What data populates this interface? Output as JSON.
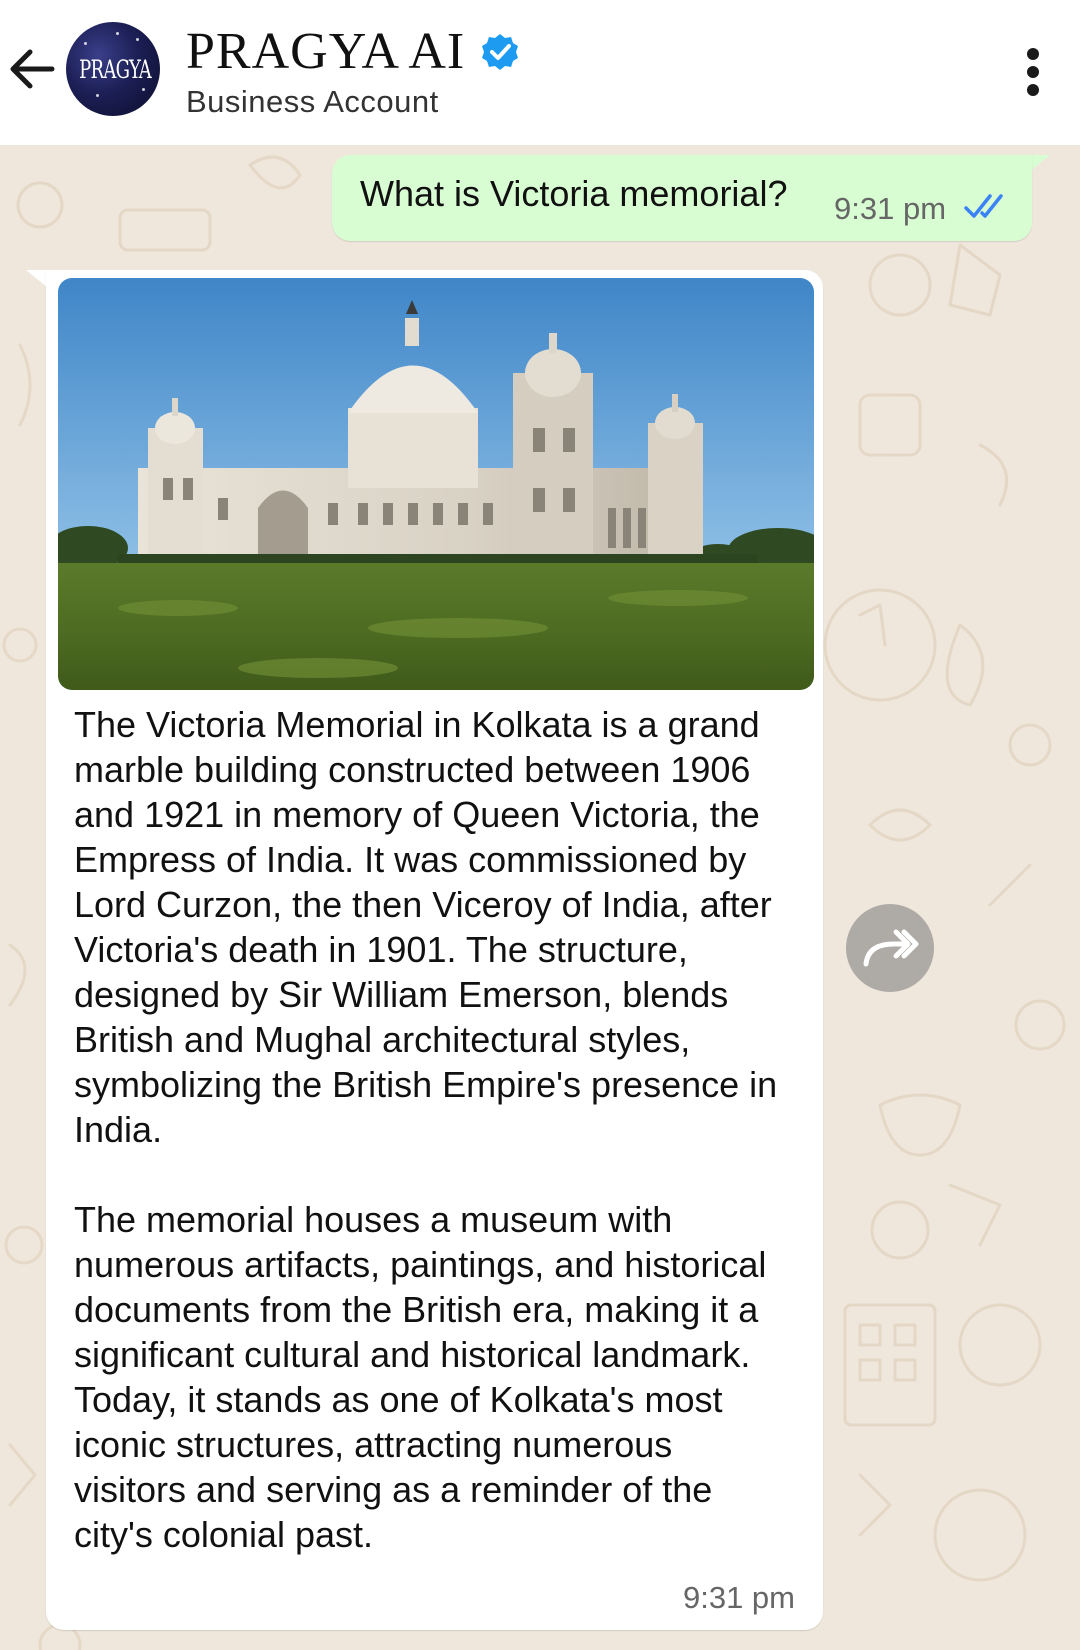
{
  "header": {
    "contact_name": "PRAGYA AI",
    "account_type": "Business Account",
    "avatar_text": "PRAGYA",
    "icons": [
      "back-arrow-icon",
      "verified-badge-icon",
      "more-options-icon"
    ]
  },
  "chat": {
    "outgoing": {
      "text": "What is Victoria memorial?",
      "time": "9:31 pm",
      "status": "read"
    },
    "incoming": {
      "image_subject": "Victoria Memorial",
      "paragraphs": [
        "The Victoria Memorial in Kolkata is a grand marble building constructed between 1906 and 1921 in memory of Queen Victoria, the Empress of India. It was commissioned by Lord Curzon, the then Viceroy of India, after Victoria's death in 1901. The structure, designed by Sir William Emerson, blends British and Mughal architectural styles, symbolizing the British Empire's presence in India.",
        "The memorial houses a museum with numerous artifacts, paintings, and historical documents from the British era, making it a significant cultural and historical landmark. Today, it stands as one of Kolkata's most iconic structures, attracting numerous visitors and serving as a reminder of the city's colonial past."
      ],
      "time": "9:31 pm"
    }
  },
  "colors": {
    "outgoing_bubble": "#d9fdd3",
    "incoming_bubble": "#ffffff",
    "chat_background": "#efe7dc",
    "read_ticks": "#3b82f6",
    "verified": "#1d9bf0"
  }
}
